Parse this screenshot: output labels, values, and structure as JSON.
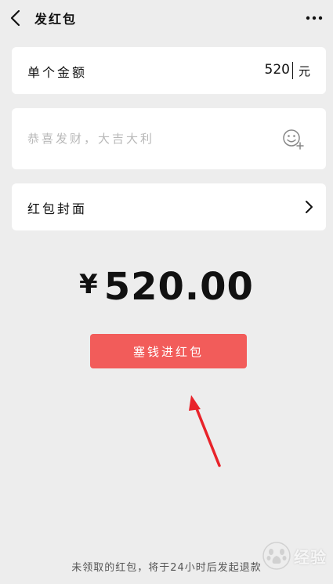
{
  "nav": {
    "title": "发红包",
    "back_icon": "back-chevron-icon",
    "more_icon": "more-dots-icon"
  },
  "amount": {
    "label": "单个金额",
    "value": "520",
    "unit": "元"
  },
  "greeting": {
    "placeholder": "恭喜发财，大吉大利",
    "emoji_icon": "emoji-add-icon"
  },
  "cover": {
    "label": "红包封面",
    "chevron_icon": "chevron-right-icon"
  },
  "total": {
    "symbol": "¥",
    "amount": "520.00"
  },
  "send_button": {
    "label": "塞钱进红包"
  },
  "footer": {
    "note": "未领取的红包，将于24小时后发起退款"
  },
  "watermark": {
    "text": "经验",
    "logo_icon": "baidu-paw-icon"
  },
  "colors": {
    "background": "#ededed",
    "card": "#ffffff",
    "button": "#f25c5a",
    "arrow": "#e8232a",
    "placeholder": "#b8b8b8"
  }
}
